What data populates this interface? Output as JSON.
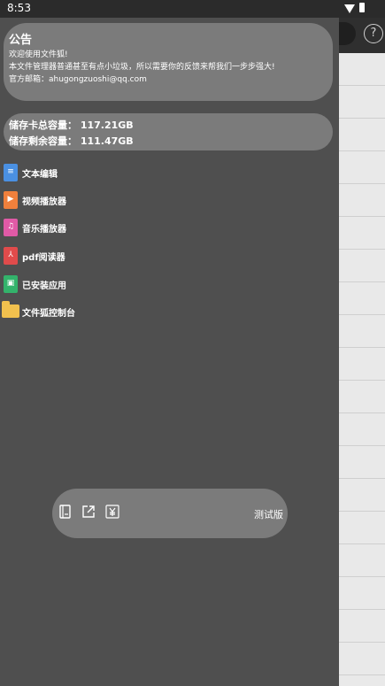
{
  "status_bar": {
    "time": "8:53"
  },
  "notice": {
    "title": "公告",
    "lines": [
      "欢迎使用文件狐!",
      "本文件管理器普通甚至有点小垃圾，所以需要你的反馈来帮我们一步步强大!",
      "官方邮箱：ahugongzuoshi@qq.com"
    ]
  },
  "storage": {
    "total": "储存卡总容量：  117.21GB",
    "free": "储存剩余容量：  111.47GB"
  },
  "menu": [
    {
      "label": "文本编辑",
      "icon": "text-file-icon",
      "color": "#4a90e2"
    },
    {
      "label": "视频播放器",
      "icon": "video-file-icon",
      "color": "#f0803c"
    },
    {
      "label": "音乐播放器",
      "icon": "music-file-icon",
      "color": "#e05aa6"
    },
    {
      "label": "pdf阅读器",
      "icon": "pdf-file-icon",
      "color": "#e04b4b"
    },
    {
      "label": "已安装应用",
      "icon": "apk-file-icon",
      "color": "#33b36b"
    },
    {
      "label": "文件狐控制台",
      "icon": "folder-icon",
      "color": "#f2c14e"
    }
  ],
  "toolbar": {
    "version_label": "测试版",
    "icons": [
      "book-icon",
      "share-external-icon",
      "yuan-icon"
    ]
  },
  "background": {
    "help_glyph": "?"
  }
}
